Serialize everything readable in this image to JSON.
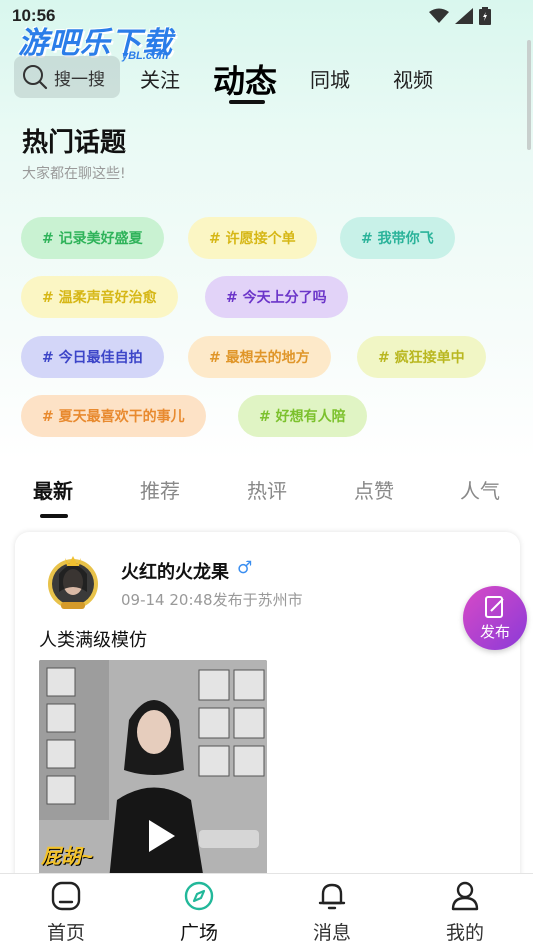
{
  "status_bar": {
    "time": "10:56"
  },
  "logo": {
    "main": "游吧乐下载",
    "sub": "yBL.com"
  },
  "search": {
    "label": "搜一搜"
  },
  "top_tabs": [
    {
      "label": "关注"
    },
    {
      "label": "动态"
    },
    {
      "label": "同城"
    },
    {
      "label": "视频"
    }
  ],
  "hot_topics": {
    "title": "热门话题",
    "subtitle": "大家都在聊这些!",
    "tags": [
      {
        "label": "# 记录美好盛夏",
        "color": "#2fb35a",
        "bg": "#c9f2d2"
      },
      {
        "label": "# 许愿接个单",
        "color": "#d6b716",
        "bg": "#fbf6c4"
      },
      {
        "label": "# 我带你飞",
        "color": "#2bb39a",
        "bg": "#c8f1e8"
      },
      {
        "label": "# 温柔声音好治愈",
        "color": "#d6b716",
        "bg": "#fbf6c4"
      },
      {
        "label": "# 今天上分了吗",
        "color": "#6b35c9",
        "bg": "#e2d3f8"
      },
      {
        "label": "# 今日最佳自拍",
        "color": "#3c45c8",
        "bg": "#d3d6f8"
      },
      {
        "label": "# 最想去的地方",
        "color": "#e0962a",
        "bg": "#fde9c9"
      },
      {
        "label": "# 疯狂接单中",
        "color": "#b9b720",
        "bg": "#f1f6c5"
      },
      {
        "label": "# 夏天最喜欢干的事儿",
        "color": "#e88a2f",
        "bg": "#fde2c6"
      },
      {
        "label": "# 好想有人陪",
        "color": "#7cc12d",
        "bg": "#e0f4c4"
      }
    ]
  },
  "feed_tabs": [
    {
      "label": "最新"
    },
    {
      "label": "推荐"
    },
    {
      "label": "热评"
    },
    {
      "label": "点赞"
    },
    {
      "label": "人气"
    }
  ],
  "post": {
    "username": "火红的火龙果",
    "gender_symbol": "♂",
    "meta": "09-14 20:48发布于苏州市",
    "text": "人类满级模仿",
    "image_caption": "屁胡~"
  },
  "publish_button": {
    "label": "发布"
  },
  "bottom_nav": [
    {
      "label": "首页",
      "icon": "home-icon"
    },
    {
      "label": "广场",
      "icon": "compass-icon"
    },
    {
      "label": "消息",
      "icon": "bell-icon"
    },
    {
      "label": "我的",
      "icon": "user-icon"
    }
  ]
}
